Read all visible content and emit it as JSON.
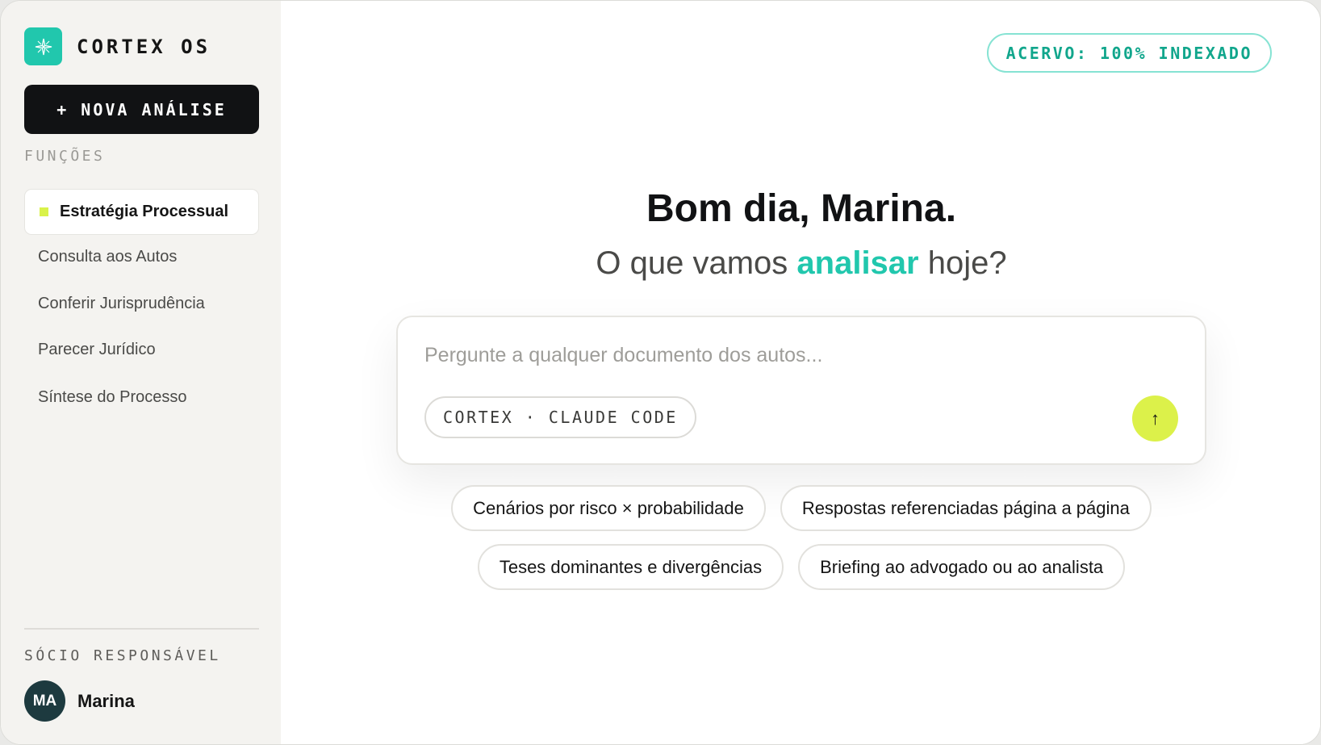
{
  "sidebar": {
    "brand": {
      "name": "CORTEX OS",
      "logo_icon": "sparkle-icon"
    },
    "new_analysis_label": "+ NOVA ANÁLISE",
    "functions_label": "FUNÇÕES",
    "active_item": {
      "label": "Estratégia Processual"
    },
    "items": [
      {
        "label": "Consulta aos Autos"
      },
      {
        "label": "Conferir Jurisprudência"
      },
      {
        "label": "Parecer Jurídico"
      },
      {
        "label": "Síntese do Processo"
      }
    ],
    "owner_section_label": "SÓCIO RESPONSÁVEL",
    "owner": {
      "initials": "MA",
      "name": "Marina"
    }
  },
  "main": {
    "status_badge": "ACERVO: 100% INDEXADO",
    "greeting": "Bom dia, Marina.",
    "subtitle": {
      "before": "O que vamos ",
      "accent": "analisar",
      "after": " hoje?"
    },
    "composer": {
      "placeholder": "Pergunte a qualquer documento dos autos...",
      "value": "",
      "model_label": "CORTEX · CLAUDE CODE",
      "send_icon": "↑"
    },
    "suggestions_row1": [
      "Cenários por risco × probabilidade",
      "Respostas referenciadas página a página"
    ],
    "suggestions_row2": [
      "Teses dominantes e divergências",
      "Briefing ao advogado ou ao analista"
    ]
  },
  "colors": {
    "accent_teal": "#21c7ad",
    "accent_lime": "#dcf14a",
    "dark": "#111214",
    "avatar_bg": "#1d3a3f"
  }
}
